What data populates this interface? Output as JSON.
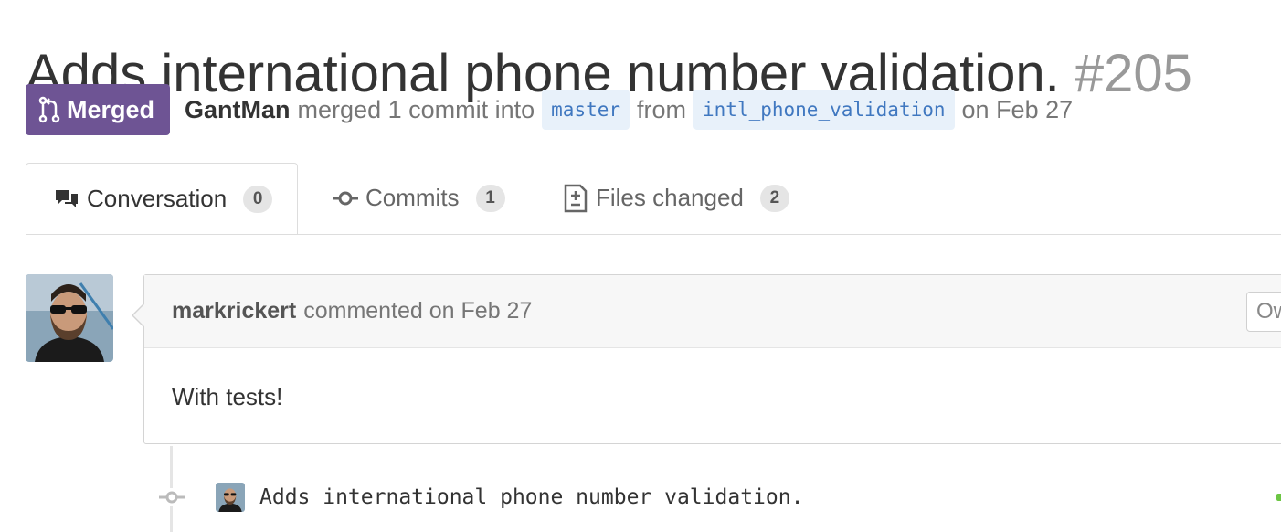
{
  "pr": {
    "title": "Adds international phone number validation.",
    "number": "#205",
    "state_label": "Merged",
    "author": "GantMan",
    "merge_text": "merged 1 commit into",
    "base_branch": "master",
    "from_text": "from",
    "head_branch": "intl_phone_validation",
    "date_text": "on Feb 27"
  },
  "tabs": [
    {
      "label": "Conversation",
      "count": "0",
      "icon": "comment-discussion-icon"
    },
    {
      "label": "Commits",
      "count": "1",
      "icon": "git-commit-icon"
    },
    {
      "label": "Files changed",
      "count": "2",
      "icon": "diff-icon"
    }
  ],
  "comment": {
    "author": "markrickert",
    "action": "commented on Feb 27",
    "owner_label": "Ow",
    "body": "With tests!"
  },
  "commit": {
    "message": "Adds international phone number validation."
  },
  "colors": {
    "merged": "#6e5494",
    "branch_bg": "#e8f1fa",
    "branch_text": "#4078c0",
    "muted": "#999999"
  }
}
